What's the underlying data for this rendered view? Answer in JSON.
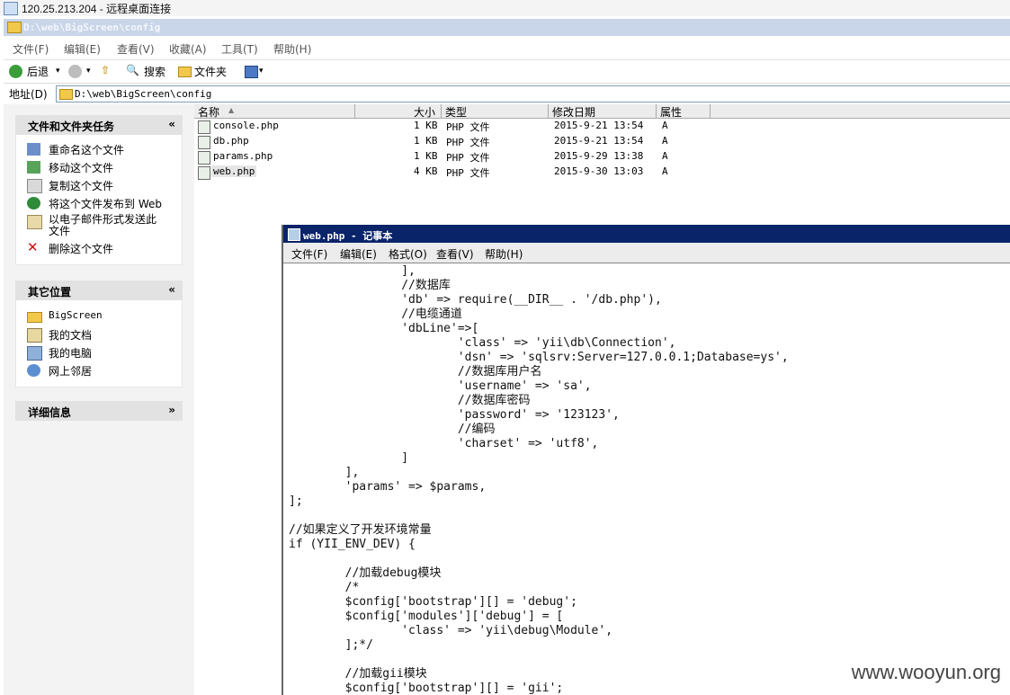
{
  "rdp": {
    "title": "120.25.213.204 - 远程桌面连接"
  },
  "explorer": {
    "title": "D:\\web\\BigScreen\\config",
    "menu": [
      "文件(F)",
      "编辑(E)",
      "查看(V)",
      "收藏(A)",
      "工具(T)",
      "帮助(H)"
    ],
    "toolbar": {
      "back": "后退",
      "search": "搜索",
      "folders": "文件夹"
    },
    "address_label": "地址(D)",
    "address_value": "D:\\web\\BigScreen\\config"
  },
  "left_pane": {
    "tasks_title": "文件和文件夹任务",
    "tasks": [
      "重命名这个文件",
      "移动这个文件",
      "复制这个文件",
      "将这个文件发布到 Web",
      "以电子邮件形式发送此文件",
      "删除这个文件"
    ],
    "places_title": "其它位置",
    "places": [
      "BigScreen",
      "我的文档",
      "我的电脑",
      "网上邻居"
    ],
    "details_title": "详细信息"
  },
  "file_list": {
    "columns": [
      "名称",
      "大小",
      "类型",
      "修改日期",
      "属性"
    ],
    "rows": [
      {
        "name": "console.php",
        "size": "1 KB",
        "type": "PHP 文件",
        "date": "2015-9-21 13:54",
        "attr": "A"
      },
      {
        "name": "db.php",
        "size": "1 KB",
        "type": "PHP 文件",
        "date": "2015-9-21 13:54",
        "attr": "A"
      },
      {
        "name": "params.php",
        "size": "1 KB",
        "type": "PHP 文件",
        "date": "2015-9-29 13:38",
        "attr": "A"
      },
      {
        "name": "web.php",
        "size": "4 KB",
        "type": "PHP 文件",
        "date": "2015-9-30 13:03",
        "attr": "A"
      }
    ]
  },
  "notepad": {
    "title": "web.php - 记事本",
    "menu": [
      "文件(F)",
      "编辑(E)",
      "格式(O)",
      "查看(V)",
      "帮助(H)"
    ],
    "content": "                ],\n                //数据库\n                'db' => require(__DIR__ . '/db.php'),\n                //电缆通道\n                'dbLine'=>[\n                        'class' => 'yii\\db\\Connection',\n                        'dsn' => 'sqlsrv:Server=127.0.0.1;Database=ys',\n                        //数据库用户名\n                        'username' => 'sa',\n                        //数据库密码\n                        'password' => '123123',\n                        //编码\n                        'charset' => 'utf8',\n                ]\n        ],\n        'params' => $params,\n];\n\n//如果定义了开发环境常量\nif (YII_ENV_DEV) {\n\n        //加载debug模块\n        /*\n        $config['bootstrap'][] = 'debug';\n        $config['modules']['debug'] = [\n                'class' => 'yii\\debug\\Module',\n        ];*/\n\n        //加载gii模块\n        $config['bootstrap'][] = 'gii';"
  },
  "watermark": "www.wooyun.org"
}
